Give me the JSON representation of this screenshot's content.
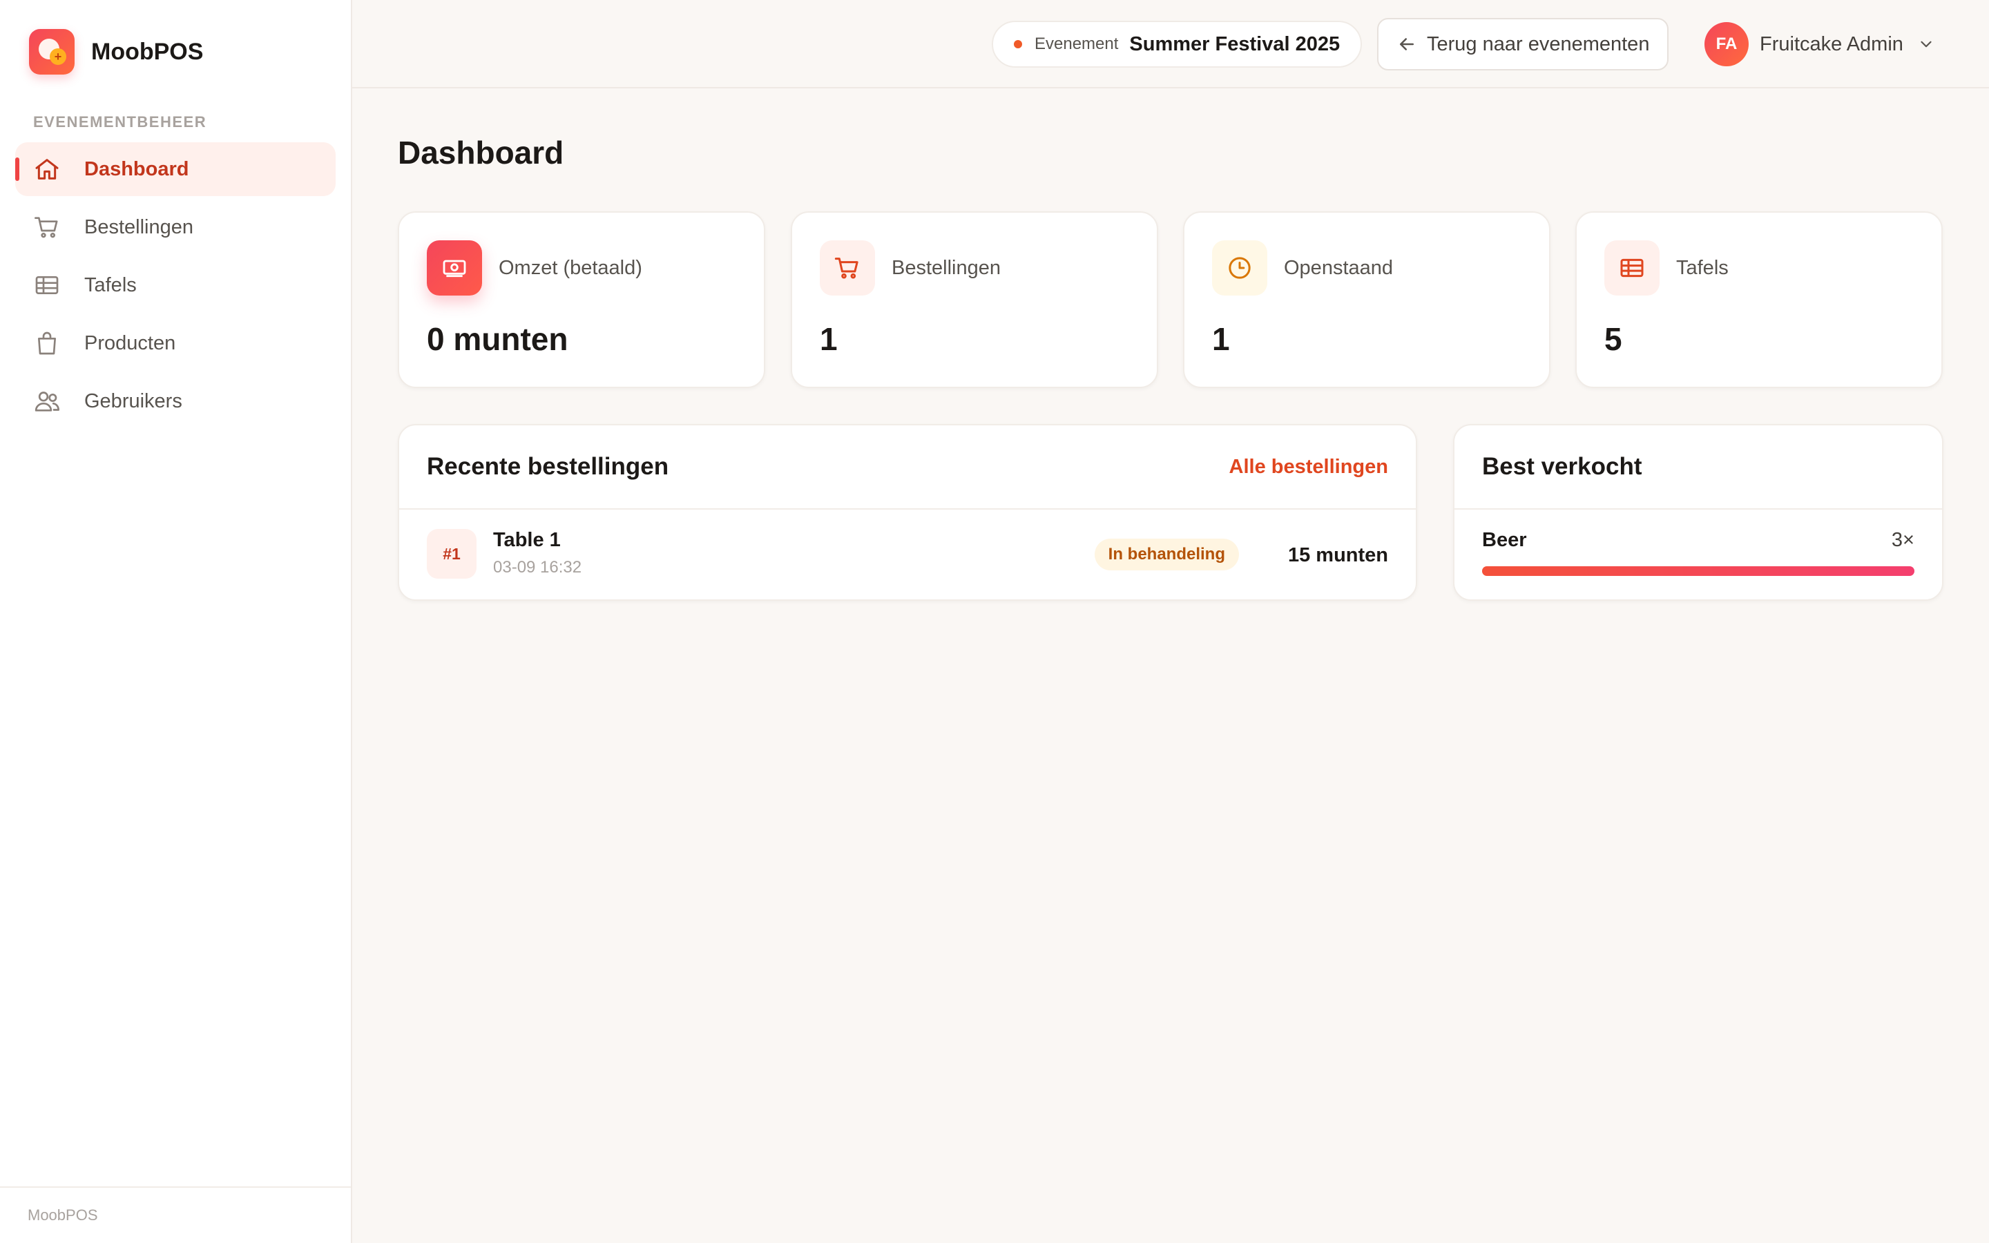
{
  "app": {
    "name": "MoobPOS"
  },
  "sidebar": {
    "section_label": "EVENEMENTBEHEER",
    "items": [
      {
        "label": "Dashboard",
        "icon": "home-icon",
        "active": true
      },
      {
        "label": "Bestellingen",
        "icon": "cart-icon",
        "active": false
      },
      {
        "label": "Tafels",
        "icon": "table-icon",
        "active": false
      },
      {
        "label": "Producten",
        "icon": "shopping-bag-icon",
        "active": false
      },
      {
        "label": "Gebruikers",
        "icon": "users-icon",
        "active": false
      }
    ],
    "footer": "MoobPOS"
  },
  "topbar": {
    "event_label": "Evenement",
    "event_name": "Summer Festival 2025",
    "back_button": "Terug naar evenementen",
    "user_initials": "FA",
    "user_name": "Fruitcake Admin"
  },
  "main": {
    "title": "Dashboard",
    "stats": [
      {
        "label": "Omzet (betaald)",
        "value": "0 munten",
        "icon": "money-icon"
      },
      {
        "label": "Bestellingen",
        "value": "1",
        "icon": "cart-icon"
      },
      {
        "label": "Openstaand",
        "value": "1",
        "icon": "clock-icon"
      },
      {
        "label": "Tafels",
        "value": "5",
        "icon": "table-icon"
      }
    ],
    "recent": {
      "title": "Recente bestellingen",
      "link": "Alle bestellingen",
      "orders": [
        {
          "number": "#1",
          "table": "Table 1",
          "date": "03-09 16:32",
          "status": "In behandeling",
          "amount": "15 munten"
        }
      ]
    },
    "best": {
      "title": "Best verkocht",
      "items": [
        {
          "name": "Beer",
          "count": "3×",
          "fraction": 1.0
        }
      ]
    }
  },
  "colors": {
    "accent": "#ef4444",
    "accent_dark": "#c2361c",
    "link": "#e0461f",
    "status_pending_bg": "#fff5e1",
    "status_pending_text": "#b45309",
    "background": "#faf7f4"
  }
}
